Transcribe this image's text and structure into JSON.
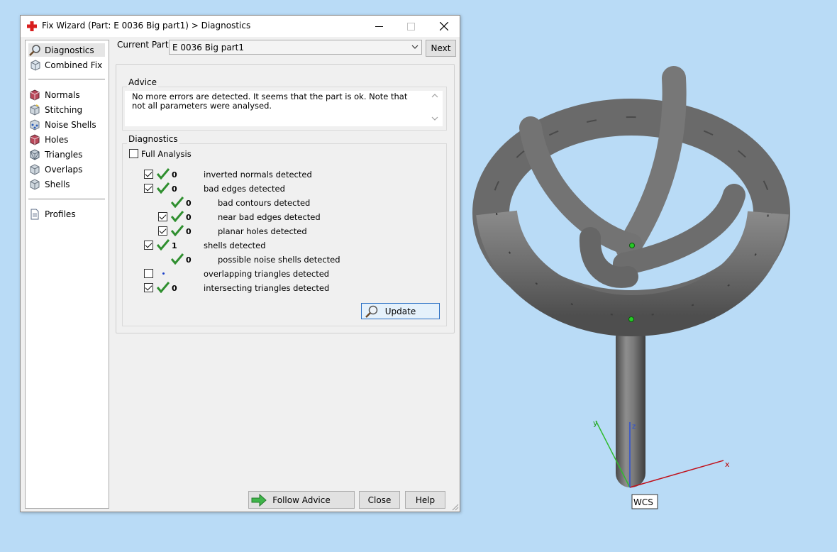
{
  "window": {
    "title": "Fix Wizard (Part: E 0036 Big part1) > Diagnostics"
  },
  "sidebar": {
    "items": [
      {
        "label": "Diagnostics",
        "icon": "magnifier-icon",
        "selected": true
      },
      {
        "label": "Combined Fix",
        "icon": "cube-fix-icon"
      },
      {
        "label": "Normals",
        "icon": "cube-normals-icon"
      },
      {
        "label": "Stitching",
        "icon": "cube-stitching-icon"
      },
      {
        "label": "Noise Shells",
        "icon": "cube-noise-shells-icon"
      },
      {
        "label": "Holes",
        "icon": "cube-holes-icon"
      },
      {
        "label": "Triangles",
        "icon": "cube-triangles-icon"
      },
      {
        "label": "Overlaps",
        "icon": "cube-overlaps-icon"
      },
      {
        "label": "Shells",
        "icon": "cube-shells-icon"
      },
      {
        "label": "Profiles",
        "icon": "document-icon"
      }
    ]
  },
  "part": {
    "label": "Current Part:",
    "value": "E 0036 Big part1",
    "next_label": "Next"
  },
  "advice": {
    "title": "Advice",
    "text": "No more errors are detected. It seems that the part is ok. Note that not all parameters were analysed."
  },
  "diagnostics": {
    "title": "Diagnostics",
    "full_analysis_label": "Full Analysis",
    "full_analysis_checked": false,
    "rows": [
      {
        "checkbox": true,
        "checked": true,
        "status": "ok",
        "count": "0",
        "label": "inverted normals detected",
        "indent": 0
      },
      {
        "checkbox": true,
        "checked": true,
        "status": "ok",
        "count": "0",
        "label": "bad edges detected",
        "indent": 0
      },
      {
        "checkbox": false,
        "checked": false,
        "status": "ok",
        "count": "0",
        "label": "bad contours detected",
        "indent": 1
      },
      {
        "checkbox": true,
        "checked": true,
        "status": "ok",
        "count": "0",
        "label": "near bad edges detected",
        "indent": 1
      },
      {
        "checkbox": true,
        "checked": true,
        "status": "ok",
        "count": "0",
        "label": "planar holes detected",
        "indent": 1
      },
      {
        "checkbox": true,
        "checked": true,
        "status": "ok",
        "count": "1",
        "label": "shells detected",
        "indent": 0
      },
      {
        "checkbox": false,
        "checked": false,
        "status": "ok",
        "count": "0",
        "label": "possible noise shells detected",
        "indent": 1
      },
      {
        "checkbox": true,
        "checked": false,
        "status": "pending",
        "count": "",
        "label": "overlapping triangles detected",
        "indent": 0
      },
      {
        "checkbox": true,
        "checked": true,
        "status": "ok",
        "count": "0",
        "label": "intersecting triangles detected",
        "indent": 0
      }
    ],
    "update_label": "Update"
  },
  "footer": {
    "follow_advice_label": "Follow Advice",
    "close_label": "Close",
    "help_label": "Help"
  },
  "viewport": {
    "axis_x_label": "x",
    "axis_y_label": "y",
    "axis_z_label": "z",
    "wcs_label": "WCS"
  }
}
